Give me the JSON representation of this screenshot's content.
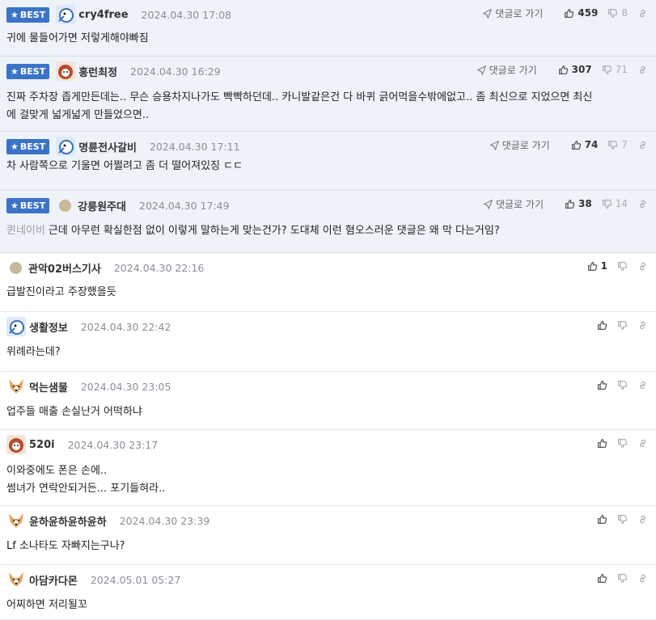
{
  "reply_label": "댓글로 가기",
  "best_label": "BEST",
  "comments": [
    {
      "best": true,
      "nick": "cry4free",
      "date": "2024.04.30 17:08",
      "text": [
        "귀에 물들어가면 저렇게해야빠짐"
      ],
      "up": "459",
      "down": "8",
      "avatar": "blue-bird-avatar"
    },
    {
      "best": true,
      "nick": "홍런최정",
      "date": "2024.04.30 16:29",
      "text": [
        "진짜 주차장 좁게만든데는.. 무슨 승용차지나가도 빡빡하던데.. 카니발같은건 다 바퀴 긁어먹을수밖에없고.. 좀 최신으로 지었으면 최신",
        "에 걸맞게 넓게넓게 만들었으면.."
      ],
      "up": "307",
      "down": "71",
      "avatar": "red-dog-avatar"
    },
    {
      "best": true,
      "nick": "명륜전사갈비",
      "date": "2024.04.30 17:11",
      "text": [
        "차 사람쪽으로 기울면 어쩔려고 좀 더 떨어져있징 ㄷㄷ"
      ],
      "up": "74",
      "down": "7",
      "avatar": "blue-bird-avatar"
    },
    {
      "best": true,
      "nick": "강릉원주대",
      "date": "2024.04.30 17:49",
      "mention": "퀸네이비",
      "text": [
        "근데 아무런 확실한점 없이 이렇게 말하는게 맞는건가? 도대체 이런 혐오스러운 댓글은 왜 막 다는거임?"
      ],
      "up": "38",
      "down": "14",
      "avatar": "dot-avatar"
    },
    {
      "best": false,
      "nick": "관악02버스기사",
      "date": "2024.04.30 22:16",
      "text": [
        "급발진이라고 주장했을듯"
      ],
      "up": "1",
      "down": "",
      "avatar": "dot-avatar"
    },
    {
      "best": false,
      "nick": "생활정보",
      "date": "2024.04.30 22:42",
      "text": [
        "위례라는데?"
      ],
      "up": "",
      "down": "",
      "avatar": "blue-bird-avatar"
    },
    {
      "best": false,
      "nick": "먹는샘물",
      "date": "2024.04.30 23:05",
      "text": [
        "업주들 매출 손실난거 어떡하냐"
      ],
      "up": "",
      "down": "",
      "avatar": "corgi-avatar"
    },
    {
      "best": false,
      "nick": "520i",
      "date": "2024.04.30 23:17",
      "text": [
        "이와중에도 폰은 손에..",
        "썸녀가 연락안되거든... 포기들혀라.."
      ],
      "up": "",
      "down": "",
      "avatar": "red-dog-avatar"
    },
    {
      "best": false,
      "nick": "윤하윤하윤하윤하",
      "date": "2024.04.30 23:39",
      "text": [
        "Lf 소나타도 자빠지는구나?"
      ],
      "up": "",
      "down": "",
      "avatar": "corgi-avatar"
    },
    {
      "best": false,
      "nick": "아담카다몬",
      "date": "2024.05.01 05:27",
      "text": [
        "어찌하면 저리될꼬"
      ],
      "up": "",
      "down": "",
      "avatar": "corgi-avatar"
    }
  ],
  "colors": {
    "best_bg": "#eef2f9",
    "badge": "#3b73c9",
    "muted": "#8a8f97"
  }
}
